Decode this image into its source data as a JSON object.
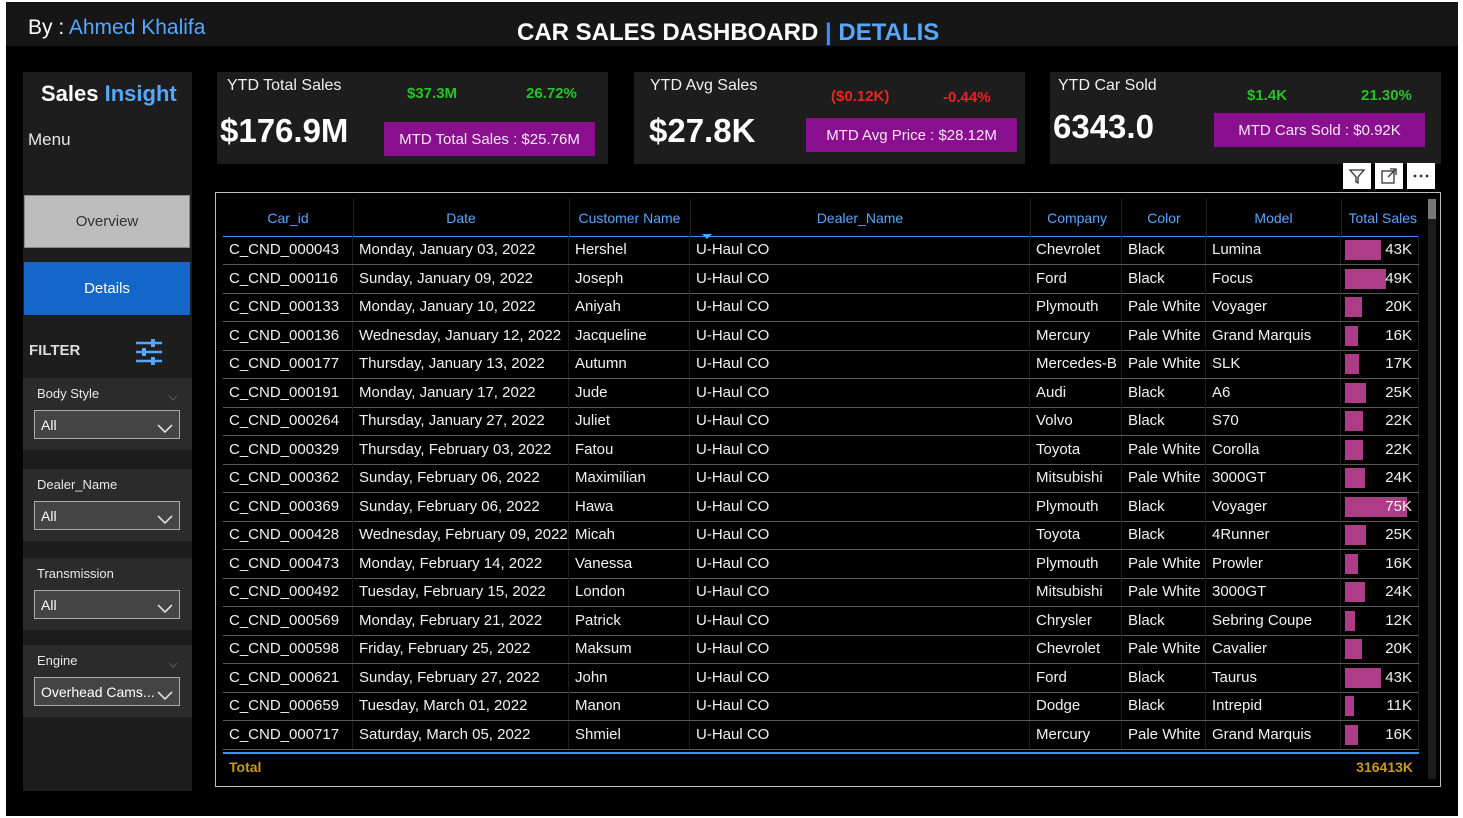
{
  "header": {
    "by_prefix": "By : ",
    "author": "Ahmed Khalifa",
    "title_main": "CAR SALES DASHBOARD",
    "title_sep": " | ",
    "title_page": "DETALIS"
  },
  "sidebar": {
    "brand_a": "Sales",
    "brand_b": " Insight",
    "menu_label": "Menu",
    "nav": {
      "overview": "Overview",
      "details": "Details"
    },
    "filter_title": "FILTER",
    "slicers": [
      {
        "label": "Body Style",
        "value": "All"
      },
      {
        "label": "Dealer_Name",
        "value": "All"
      },
      {
        "label": "Transmission",
        "value": "All"
      },
      {
        "label": "Engine",
        "value": "Overhead Cams..."
      }
    ]
  },
  "kpis": [
    {
      "title": "YTD Total Sales",
      "value": "$176.9M",
      "delta1": "$37.3M",
      "delta2": "26.72%",
      "delta_color": "green",
      "button": "MTD Total Sales : $25.76M"
    },
    {
      "title": "YTD Avg Sales",
      "value": "$27.8K",
      "delta1": "($0.12K)",
      "delta2": "-0.44%",
      "delta_color": "red",
      "button": "MTD Avg Price : $28.12M"
    },
    {
      "title": "YTD Car Sold",
      "value": "6343.0",
      "delta1": "$1.4K",
      "delta2": "21.30%",
      "delta_color": "green",
      "button": "MTD Cars Sold : $0.92K"
    }
  ],
  "toolbar": {
    "filter_icon": "filter-icon",
    "focus_icon": "focus-mode-icon",
    "more_icon": "more-options-icon"
  },
  "table": {
    "columns": [
      "Car_id",
      "Date",
      "Customer Name",
      "Dealer_Name",
      "Company",
      "Color",
      "Model",
      "Total Sales"
    ],
    "rows": [
      {
        "id": "C_CND_000043",
        "date": "Monday, January 03, 2022",
        "customer": "Hershel",
        "dealer": "U-Haul CO",
        "company": "Chevrolet",
        "color": "Black",
        "model": "Lumina",
        "sales": "43K",
        "sales_value": 43
      },
      {
        "id": "C_CND_000116",
        "date": "Sunday, January 09, 2022",
        "customer": "Joseph",
        "dealer": "U-Haul CO",
        "company": "Ford",
        "color": "Black",
        "model": "Focus",
        "sales": "49K",
        "sales_value": 49
      },
      {
        "id": "C_CND_000133",
        "date": "Monday, January 10, 2022",
        "customer": "Aniyah",
        "dealer": "U-Haul CO",
        "company": "Plymouth",
        "color": "Pale White",
        "model": "Voyager",
        "sales": "20K",
        "sales_value": 20
      },
      {
        "id": "C_CND_000136",
        "date": "Wednesday, January 12, 2022",
        "customer": "Jacqueline",
        "dealer": "U-Haul CO",
        "company": "Mercury",
        "color": "Pale White",
        "model": "Grand Marquis",
        "sales": "16K",
        "sales_value": 16
      },
      {
        "id": "C_CND_000177",
        "date": "Thursday, January 13, 2022",
        "customer": "Autumn",
        "dealer": "U-Haul CO",
        "company": "Mercedes-B",
        "color": "Pale White",
        "model": "SLK",
        "sales": "17K",
        "sales_value": 17
      },
      {
        "id": "C_CND_000191",
        "date": "Monday, January 17, 2022",
        "customer": "Jude",
        "dealer": "U-Haul CO",
        "company": "Audi",
        "color": "Black",
        "model": "A6",
        "sales": "25K",
        "sales_value": 25
      },
      {
        "id": "C_CND_000264",
        "date": "Thursday, January 27, 2022",
        "customer": "Juliet",
        "dealer": "U-Haul CO",
        "company": "Volvo",
        "color": "Black",
        "model": "S70",
        "sales": "22K",
        "sales_value": 22
      },
      {
        "id": "C_CND_000329",
        "date": "Thursday, February 03, 2022",
        "customer": "Fatou",
        "dealer": "U-Haul CO",
        "company": "Toyota",
        "color": "Pale White",
        "model": "Corolla",
        "sales": "22K",
        "sales_value": 22
      },
      {
        "id": "C_CND_000362",
        "date": "Sunday, February 06, 2022",
        "customer": "Maximilian",
        "dealer": "U-Haul CO",
        "company": "Mitsubishi",
        "color": "Pale White",
        "model": "3000GT",
        "sales": "24K",
        "sales_value": 24
      },
      {
        "id": "C_CND_000369",
        "date": "Sunday, February 06, 2022",
        "customer": "Hawa",
        "dealer": "U-Haul CO",
        "company": "Plymouth",
        "color": "Black",
        "model": "Voyager",
        "sales": "75K",
        "sales_value": 75
      },
      {
        "id": "C_CND_000428",
        "date": "Wednesday, February 09, 2022",
        "customer": "Micah",
        "dealer": "U-Haul CO",
        "company": "Toyota",
        "color": "Black",
        "model": "4Runner",
        "sales": "25K",
        "sales_value": 25
      },
      {
        "id": "C_CND_000473",
        "date": "Monday, February 14, 2022",
        "customer": "Vanessa",
        "dealer": "U-Haul CO",
        "company": "Plymouth",
        "color": "Pale White",
        "model": "Prowler",
        "sales": "16K",
        "sales_value": 16
      },
      {
        "id": "C_CND_000492",
        "date": "Tuesday, February 15, 2022",
        "customer": "London",
        "dealer": "U-Haul CO",
        "company": "Mitsubishi",
        "color": "Pale White",
        "model": "3000GT",
        "sales": "24K",
        "sales_value": 24
      },
      {
        "id": "C_CND_000569",
        "date": "Monday, February 21, 2022",
        "customer": "Patrick",
        "dealer": "U-Haul CO",
        "company": "Chrysler",
        "color": "Black",
        "model": "Sebring Coupe",
        "sales": "12K",
        "sales_value": 12
      },
      {
        "id": "C_CND_000598",
        "date": "Friday, February 25, 2022",
        "customer": "Maksum",
        "dealer": "U-Haul CO",
        "company": "Chevrolet",
        "color": "Pale White",
        "model": "Cavalier",
        "sales": "20K",
        "sales_value": 20
      },
      {
        "id": "C_CND_000621",
        "date": "Sunday, February 27, 2022",
        "customer": "John",
        "dealer": "U-Haul CO",
        "company": "Ford",
        "color": "Black",
        "model": "Taurus",
        "sales": "43K",
        "sales_value": 43
      },
      {
        "id": "C_CND_000659",
        "date": "Tuesday, March 01, 2022",
        "customer": "Manon",
        "dealer": "U-Haul CO",
        "company": "Dodge",
        "color": "Black",
        "model": "Intrepid",
        "sales": "11K",
        "sales_value": 11
      },
      {
        "id": "C_CND_000717",
        "date": "Saturday, March 05, 2022",
        "customer": "Shmiel",
        "dealer": "U-Haul CO",
        "company": "Mercury",
        "color": "Pale White",
        "model": "Grand Marquis",
        "sales": "16K",
        "sales_value": 16
      }
    ],
    "sales_max": 75,
    "total_label": "Total",
    "total_value": "316413K"
  },
  "colors": {
    "accent_blue": "#56a7ff",
    "kpi_button": "#8a0f8e",
    "data_bar": "#ac3d86",
    "positive": "#25c425",
    "negative": "#ee2222",
    "total_text": "#c9991a"
  }
}
